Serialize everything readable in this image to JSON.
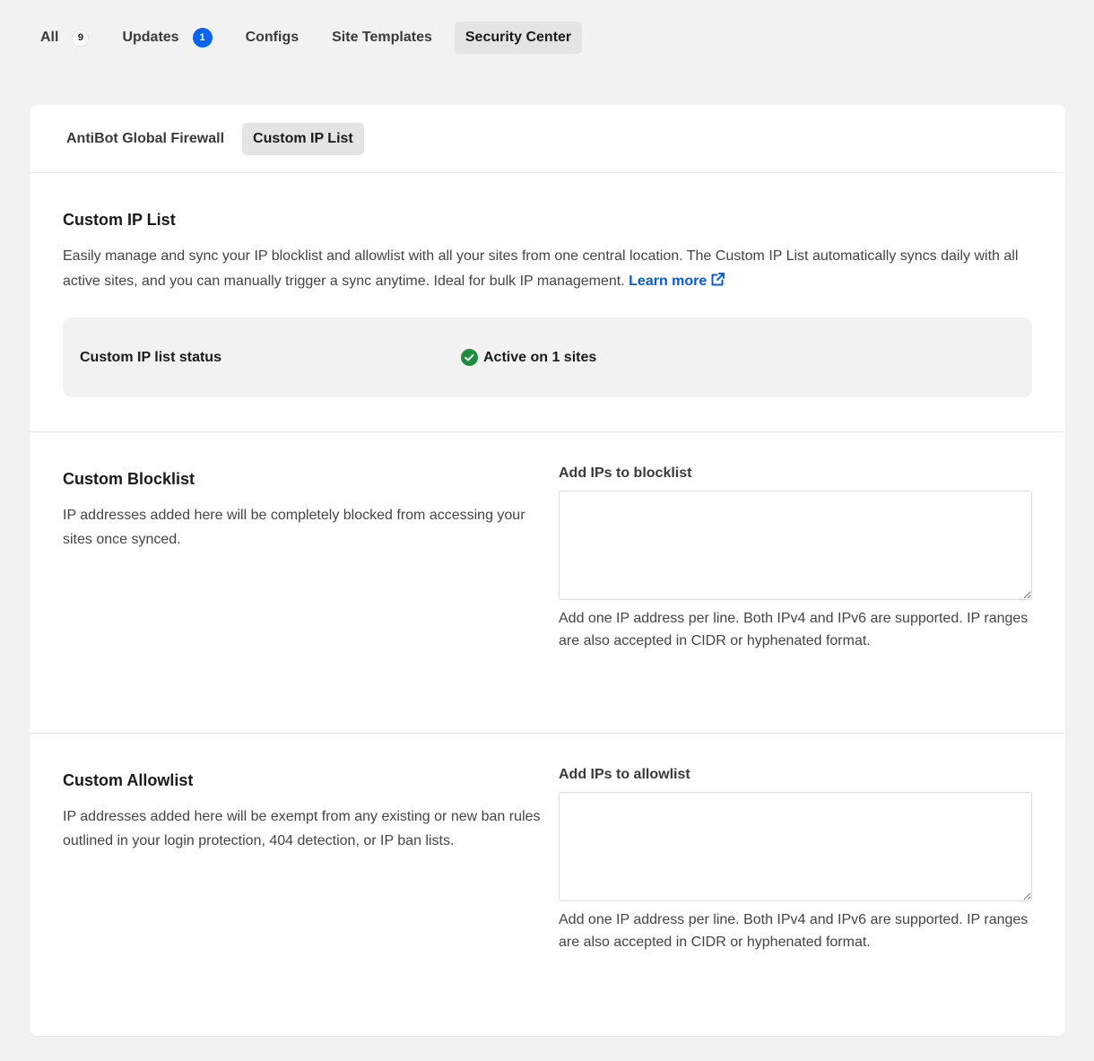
{
  "top_tabs": [
    {
      "label": "All",
      "badge": "9"
    },
    {
      "label": "Updates",
      "badge": "1"
    },
    {
      "label": "Configs"
    },
    {
      "label": "Site Templates"
    },
    {
      "label": "Security Center"
    }
  ],
  "sub_tabs": [
    "AntiBot Global Firewall",
    "Custom IP List"
  ],
  "intro": {
    "title": "Custom IP List",
    "description": "Easily manage and sync your IP blocklist and allowlist with all your sites from one central location. The Custom IP List automatically syncs daily with all active sites, and you can manually trigger a sync anytime. Ideal for bulk IP management.",
    "learn_more": "Learn more",
    "status_label": "Custom IP list status",
    "status_value": "Active on 1 sites",
    "status_icon": "check-circle-icon"
  },
  "blocklist": {
    "title": "Custom Blocklist",
    "description": "IP addresses added here will be completely blocked from accessing your sites once synced.",
    "field_label": "Add IPs to blocklist",
    "value": "",
    "hint": "Add one IP address per line. Both IPv4 and IPv6 are supported. IP ranges are also accepted in CIDR or hyphenated format."
  },
  "allowlist": {
    "title": "Custom Allowlist",
    "description": "IP addresses added here will be exempt from any existing or new ban rules outlined in your login protection, 404 detection, or IP ban lists.",
    "field_label": "Add IPs to allowlist",
    "value": "",
    "hint": "Add one IP address per line. Both IPv4 and IPv6 are supported. IP ranges are also accepted in CIDR or hyphenated format."
  },
  "colors": {
    "accent": "#0a63f1",
    "link": "#0a5bd8",
    "success": "#1e8e3e"
  }
}
